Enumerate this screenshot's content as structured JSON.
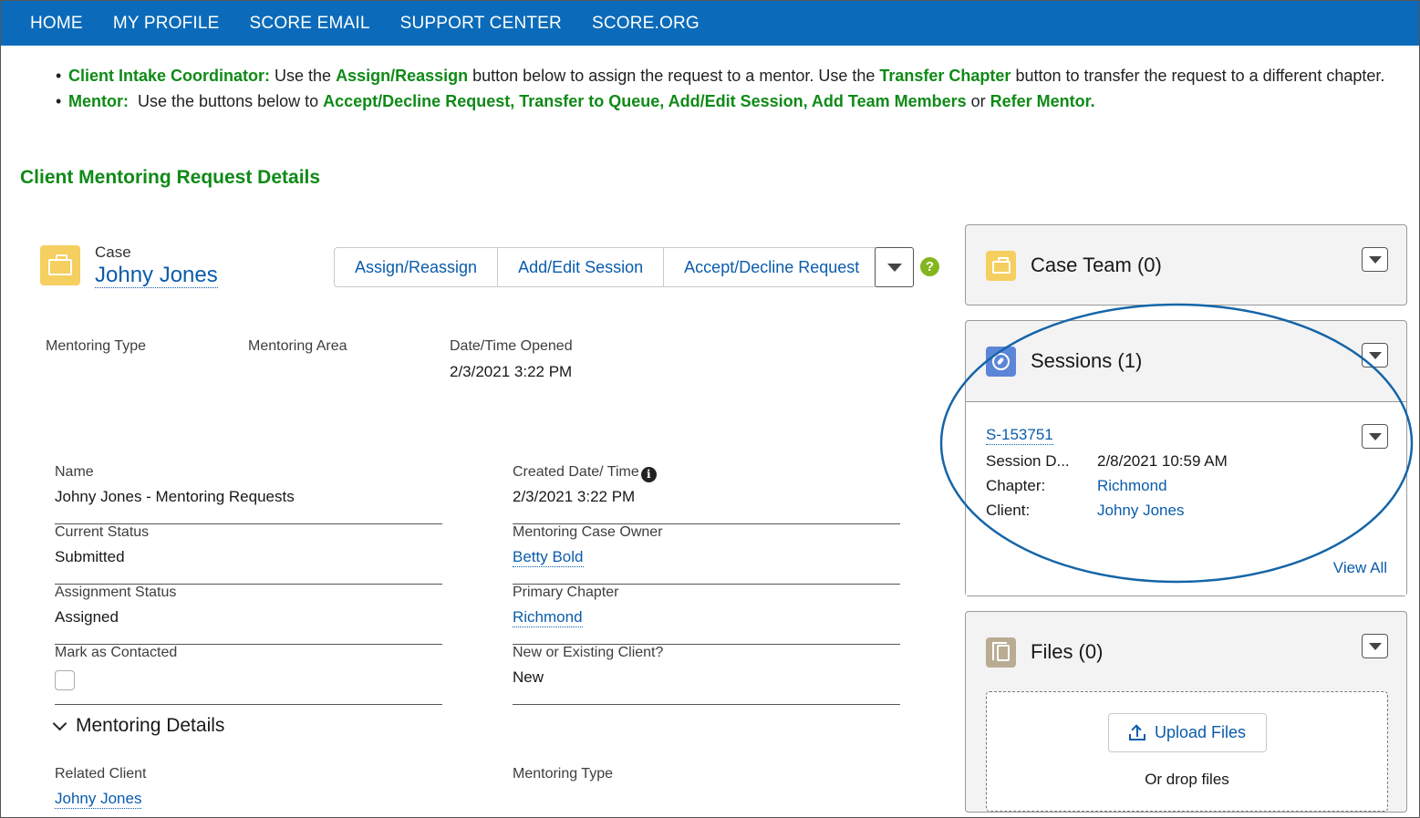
{
  "nav": [
    "HOME",
    "MY PROFILE",
    "SCORE EMAIL",
    "SUPPORT CENTER",
    "SCORE.ORG"
  ],
  "instructions": {
    "line1": {
      "role": "Client Intake Coordinator:",
      "t1": " Use the ",
      "k1": "Assign/Reassign",
      "t2": " button below to assign the request to a mentor. Use the ",
      "k2": "Transfer Chapter",
      "t3": " button to transfer the request to a different chapter."
    },
    "line2": {
      "role": "Mentor:",
      "t1": "  Use the buttons below to ",
      "k1": "Accept/Decline Request, Transfer to Queue, Add/Edit Session, Add Team Members",
      "t2": " or ",
      "k2": "Refer Mentor."
    }
  },
  "section_title": "Client Mentoring Request Details",
  "case": {
    "label": "Case",
    "name": "Johny Jones",
    "icon": "briefcase-icon"
  },
  "actions": [
    "Assign/Reassign",
    "Add/Edit Session",
    "Accept/Decline Request"
  ],
  "highlights": {
    "mentoring_type_label": "Mentoring Type",
    "mentoring_area_label": "Mentoring Area",
    "opened_label": "Date/Time Opened",
    "opened_value": "2/3/2021 3:22 PM"
  },
  "fields": {
    "name_label": "Name",
    "name_value": "Johny Jones - Mentoring Requests",
    "created_label": "Created Date/ Time",
    "created_value": "2/3/2021 3:22 PM",
    "status_label": "Current Status",
    "status_value": "Submitted",
    "owner_label": "Mentoring Case Owner",
    "owner_value": "Betty Bold",
    "assignment_label": "Assignment Status",
    "assignment_value": "Assigned",
    "chapter_label": "Primary Chapter",
    "chapter_value": "Richmond",
    "contacted_label": "Mark as Contacted",
    "client_type_label": "New or Existing Client?",
    "client_type_value": "New"
  },
  "mentoring_details": {
    "title": "Mentoring Details",
    "related_client_label": "Related Client",
    "related_client_value": "Johny Jones",
    "mentoring_type_label": "Mentoring Type"
  },
  "case_team": {
    "title": "Case Team (0)"
  },
  "sessions": {
    "title": "Sessions (1)",
    "record_id": "S-153751",
    "date_label": "Session D...",
    "date_value": "2/8/2021 10:59 AM",
    "chapter_label": "Chapter:",
    "chapter_value": "Richmond",
    "client_label": "Client:",
    "client_value": "Johny Jones",
    "view_all": "View All"
  },
  "files": {
    "title": "Files (0)",
    "upload_label": "Upload Files",
    "drop_text": "Or drop files"
  },
  "colors": {
    "nav_bg": "#0b6bba",
    "accent_green": "#0f8a17",
    "link_blue": "#0b5cab",
    "highlight_ellipse": "#1565a8"
  }
}
